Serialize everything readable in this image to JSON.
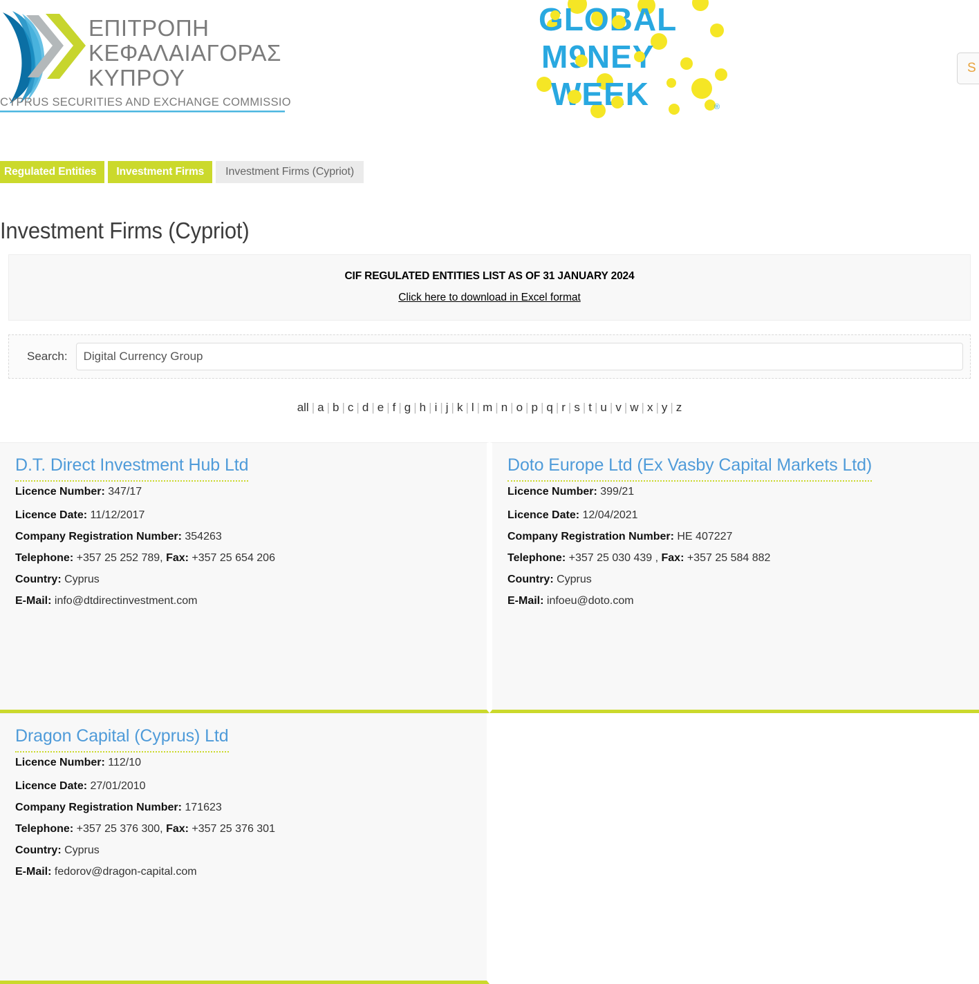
{
  "header": {
    "cysec_logo": {
      "line1": "ΕΠΙΤΡΟΠΗ",
      "line2": "ΚΕΦΑΛΑΙΑΓΟΡΑΣ",
      "line3": "ΚΥΠΡΟΥ",
      "subtitle": "CYPRUS SECURITIES AND EXCHANGE COMMISSION",
      "icon": "cysec-chevron-logo"
    },
    "gmw_logo": {
      "line1": "GLOBAL",
      "line2": "M9NEY",
      "line3": "WEEK",
      "trademark": "®",
      "icon": "global-money-week-logo"
    },
    "corner_button_label": "S"
  },
  "breadcrumb": {
    "items": [
      {
        "label": "Regulated Entities",
        "current": false
      },
      {
        "label": "Investment Firms",
        "current": false
      },
      {
        "label": "Investment Firms (Cypriot)",
        "current": true
      }
    ]
  },
  "page": {
    "title": "Investment Firms (Cypriot)"
  },
  "notice": {
    "title": "CIF REGULATED ENTITIES LIST AS OF 31 JANUARY 2024",
    "link_label": "Click here to download in Excel format"
  },
  "search": {
    "label": "Search:",
    "value": "Digital Currency Group",
    "placeholder": ""
  },
  "alphabet": {
    "items": [
      "all",
      "a",
      "b",
      "c",
      "d",
      "e",
      "f",
      "g",
      "h",
      "i",
      "j",
      "k",
      "l",
      "m",
      "n",
      "o",
      "p",
      "q",
      "r",
      "s",
      "t",
      "u",
      "v",
      "w",
      "x",
      "y",
      "z"
    ],
    "separator": "|"
  },
  "labels": {
    "licence_number": "Licence Number",
    "licence_date": "Licence Date:",
    "company_registration_number": "Company Registration Number",
    "telephone": "Telephone",
    "fax": "Fax:",
    "country": "Country",
    "email": "E-Mail"
  },
  "colors": {
    "brand_green": "#cbd92c",
    "link_blue": "#4f9bd9",
    "breadcrumb_current_bg": "#ebebeb",
    "card_bg": "#f8f8f8",
    "gmw_blue": "#29a8e0",
    "gmw_yellow": "#f5e625"
  },
  "entities": [
    {
      "name": "D.T. Direct Investment Hub Ltd",
      "licence_number": "347/17",
      "licence_date": "11/12/2017",
      "company_registration_number": "354263",
      "telephone": "+357 25 252 789,",
      "fax": "+357 25 654 206",
      "country": "Cyprus",
      "email": "info@dtdirectinvestment.com"
    },
    {
      "name": "Doto Europe Ltd (Ex Vasby Capital Markets Ltd)",
      "licence_number": "399/21",
      "licence_date": "12/04/2021",
      "company_registration_number": "HE 407227",
      "telephone": "+357 25 030 439 ,",
      "fax": "+357 25 584 882",
      "country": "Cyprus",
      "email": "infoeu@doto.com"
    },
    {
      "name": "Dragon Capital (Cyprus) Ltd",
      "licence_number": "112/10",
      "licence_date": "27/01/2010",
      "company_registration_number": "171623",
      "telephone": "+357 25 376 300,",
      "fax": "+357 25 376 301",
      "country": "Cyprus",
      "email": "fedorov@dragon-capital.com"
    }
  ]
}
